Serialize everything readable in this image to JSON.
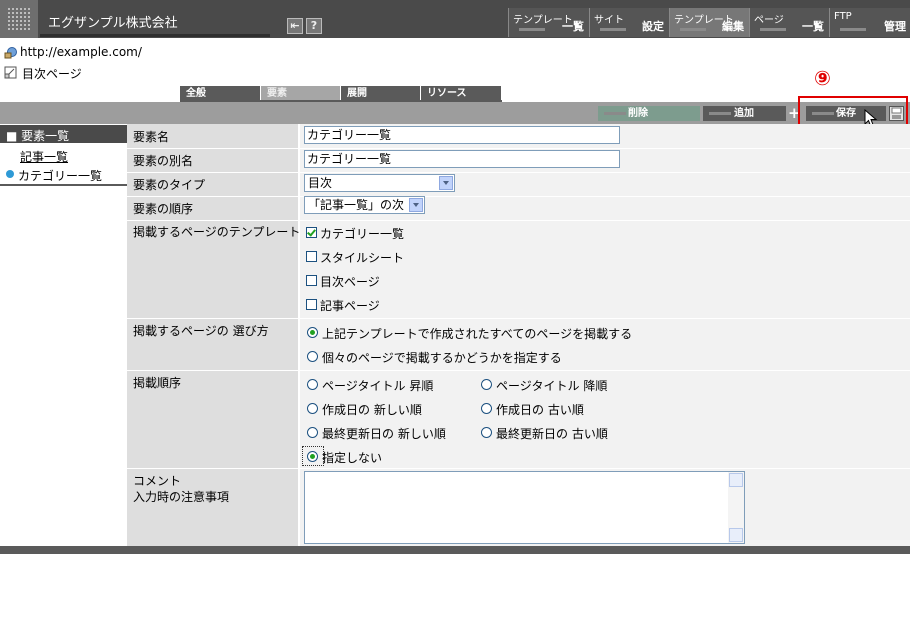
{
  "header": {
    "company": "エグザンプル株式会社",
    "icon_buttons": [
      "⇤",
      "?"
    ],
    "nav": [
      {
        "top": "テンプレート",
        "bottom": "一覧"
      },
      {
        "top": "サイト",
        "bottom": "設定"
      },
      {
        "top": "テンプレート",
        "bottom": "編集"
      },
      {
        "top": "ページ",
        "bottom": "一覧"
      },
      {
        "top": "FTP",
        "bottom": "管理"
      }
    ]
  },
  "breadcrumb": {
    "site_url": "http://example.com/",
    "page_name": "目次ページ"
  },
  "tabs": [
    "全般",
    "要素",
    "展開",
    "リソース"
  ],
  "toolbar": {
    "delete_label": "削除",
    "add_label": "追加",
    "save_label": "保存",
    "plus": "+",
    "step_number": "⑨"
  },
  "sidebar": {
    "header": "■ 要素一覧",
    "items": [
      "記事一覧",
      "カテゴリー一覧"
    ]
  },
  "form": {
    "element_name": {
      "label": "要素名",
      "value": "カテゴリー一覧"
    },
    "element_alias": {
      "label": "要素の別名",
      "value": "カテゴリー一覧"
    },
    "element_type": {
      "label": "要素のタイプ",
      "value": "目次"
    },
    "element_order": {
      "label": "要素の順序",
      "value": "「記事一覧」の次"
    },
    "templates": {
      "label": "掲載するページのテンプレート",
      "options": [
        {
          "label": "カテゴリー一覧",
          "checked": true
        },
        {
          "label": "スタイルシート",
          "checked": false
        },
        {
          "label": "目次ページ",
          "checked": false
        },
        {
          "label": "記事ページ",
          "checked": false
        }
      ]
    },
    "selection": {
      "label": "掲載するページの 選び方",
      "options": [
        {
          "label": "上記テンプレートで作成されたすべてのページを掲載する",
          "selected": true
        },
        {
          "label": "個々のページで掲載するかどうかを指定する",
          "selected": false
        }
      ]
    },
    "order": {
      "label": "掲載順序",
      "options": [
        {
          "label": "ページタイトル 昇順",
          "selected": false
        },
        {
          "label": "ページタイトル 降順",
          "selected": false
        },
        {
          "label": "作成日の 新しい順",
          "selected": false
        },
        {
          "label": "作成日の 古い順",
          "selected": false
        },
        {
          "label": "最終更新日の 新しい順",
          "selected": false
        },
        {
          "label": "最終更新日の 古い順",
          "selected": false
        },
        {
          "label": "指定しない",
          "selected": true
        }
      ]
    },
    "comment": {
      "label_line1": "コメント",
      "label_line2": "入力時の注意事項",
      "value": ""
    }
  }
}
